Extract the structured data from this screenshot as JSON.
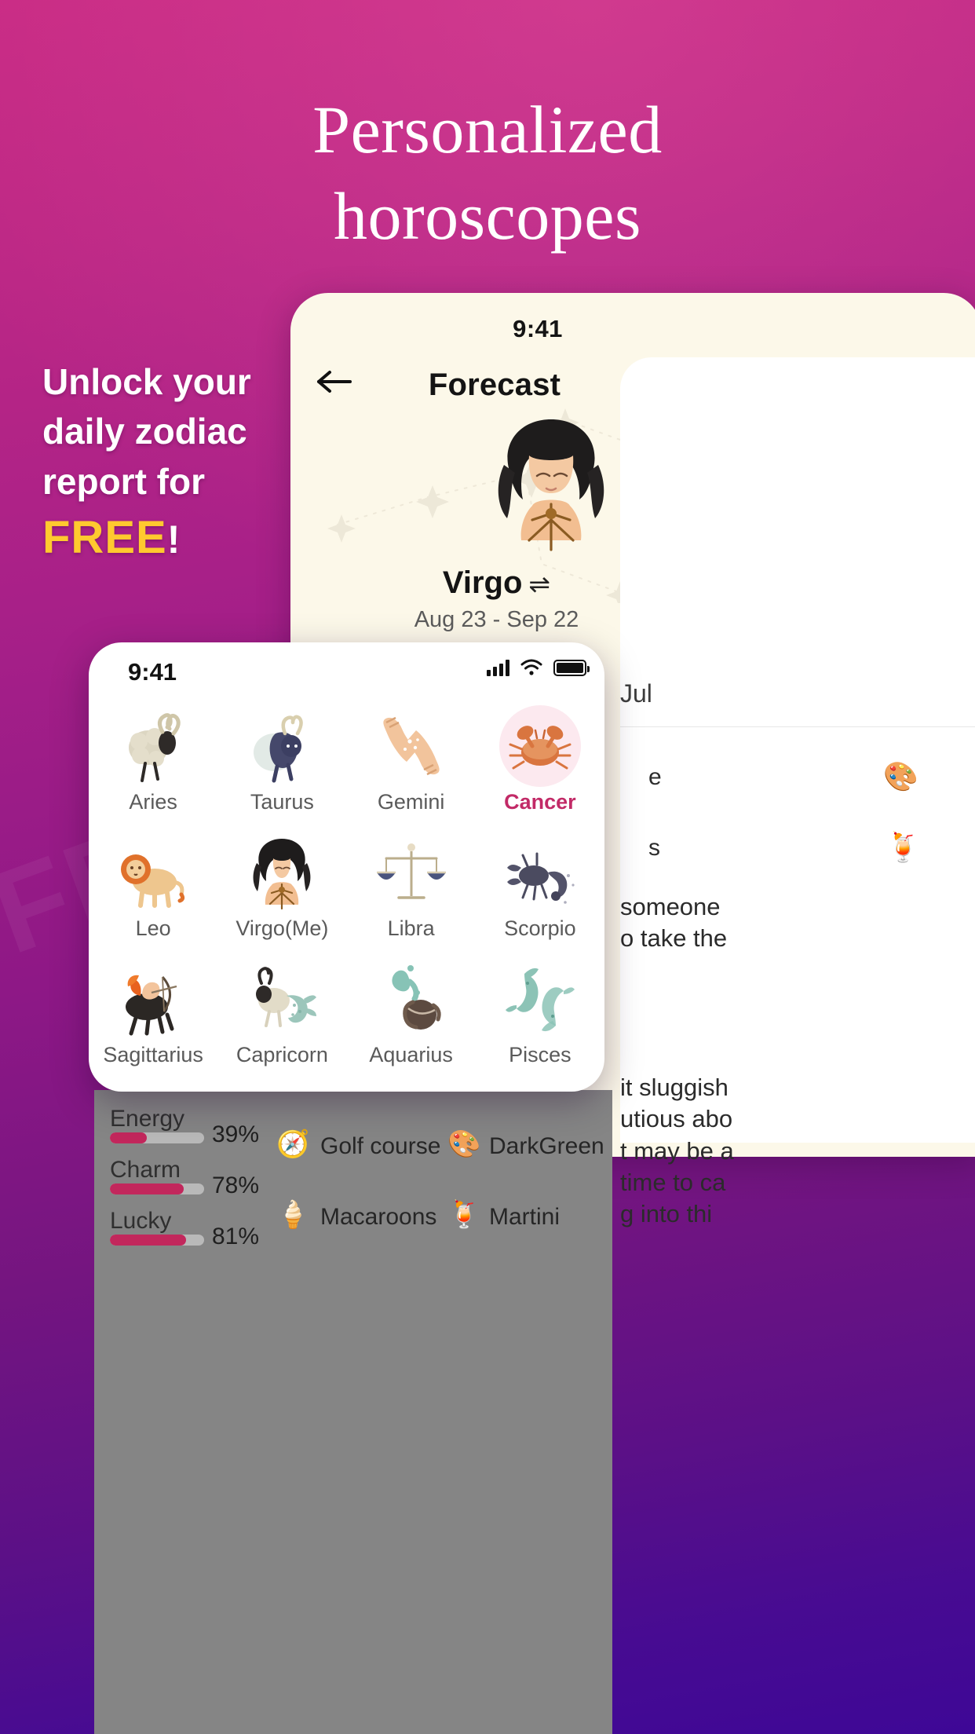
{
  "background": {
    "gradient_top": "#C82A84",
    "gradient_bottom": "#3E0796",
    "watermark_text": "FREE"
  },
  "headline": {
    "line1": "Personalized",
    "line2": "horoscopes"
  },
  "promo": {
    "line1": "Unlock your",
    "line2": "daily zodiac",
    "line3": "report for",
    "free": "FREE",
    "bang": "!",
    "free_color": "#FFC92F"
  },
  "forecast_card": {
    "status_time": "9:41",
    "back_icon": "arrow-left-icon",
    "title": "Forecast",
    "sign_art": "virgo-maiden-illustration",
    "sign_name": "Virgo",
    "sign_swap_icon": "⇌",
    "date_range": "Aug 23 - Sep 22",
    "month": "Jul",
    "chips": [
      {
        "icon": "palette-icon",
        "glyph": "🎨",
        "text": "e"
      },
      {
        "icon": "cocktail-icon",
        "glyph": "🍹",
        "text": "s"
      }
    ],
    "body_line1": "someone",
    "body_line2": "o take the",
    "body_line3": "it sluggish",
    "body_line4": "utious abo",
    "body_line5": "t may be a",
    "body_line6": "time to ca",
    "body_line7": "g into thi"
  },
  "stats_panel": {
    "rows": [
      {
        "label": "Energy",
        "percent": "39%",
        "value": 39
      },
      {
        "label": "Charm",
        "percent": "78%",
        "value": 78
      },
      {
        "label": "Lucky",
        "percent": "81%",
        "value": 81
      }
    ],
    "bar_color": "#C2275C",
    "recommendations": [
      {
        "icon": "compass-icon",
        "glyph": "🧭",
        "text": "Golf course"
      },
      {
        "icon": "palette-icon",
        "glyph": "🎨",
        "text": "DarkGreen"
      },
      {
        "icon": "icecream-icon",
        "glyph": "🍦",
        "text": "Macaroons"
      },
      {
        "icon": "cocktail-icon",
        "glyph": "🍹",
        "text": "Martini"
      }
    ]
  },
  "zodiac_card": {
    "status_time": "9:41",
    "status_icons": [
      "signal-bars-icon",
      "wifi-icon",
      "battery-icon"
    ],
    "active_sign": "Cancer",
    "active_color": "#C22A67",
    "signs": [
      {
        "label": "Aries",
        "art": "ram-illustration"
      },
      {
        "label": "Taurus",
        "art": "bull-illustration"
      },
      {
        "label": "Gemini",
        "art": "twin-hands-illustration"
      },
      {
        "label": "Cancer",
        "art": "crab-illustration"
      },
      {
        "label": "Leo",
        "art": "lion-illustration"
      },
      {
        "label": "Virgo(Me)",
        "art": "maiden-illustration"
      },
      {
        "label": "Libra",
        "art": "scales-illustration"
      },
      {
        "label": "Scorpio",
        "art": "scorpion-illustration"
      },
      {
        "label": "Sagittarius",
        "art": "centaur-archer-illustration"
      },
      {
        "label": "Capricorn",
        "art": "sea-goat-illustration"
      },
      {
        "label": "Aquarius",
        "art": "water-bearer-illustration"
      },
      {
        "label": "Pisces",
        "art": "two-fish-illustration"
      }
    ]
  }
}
